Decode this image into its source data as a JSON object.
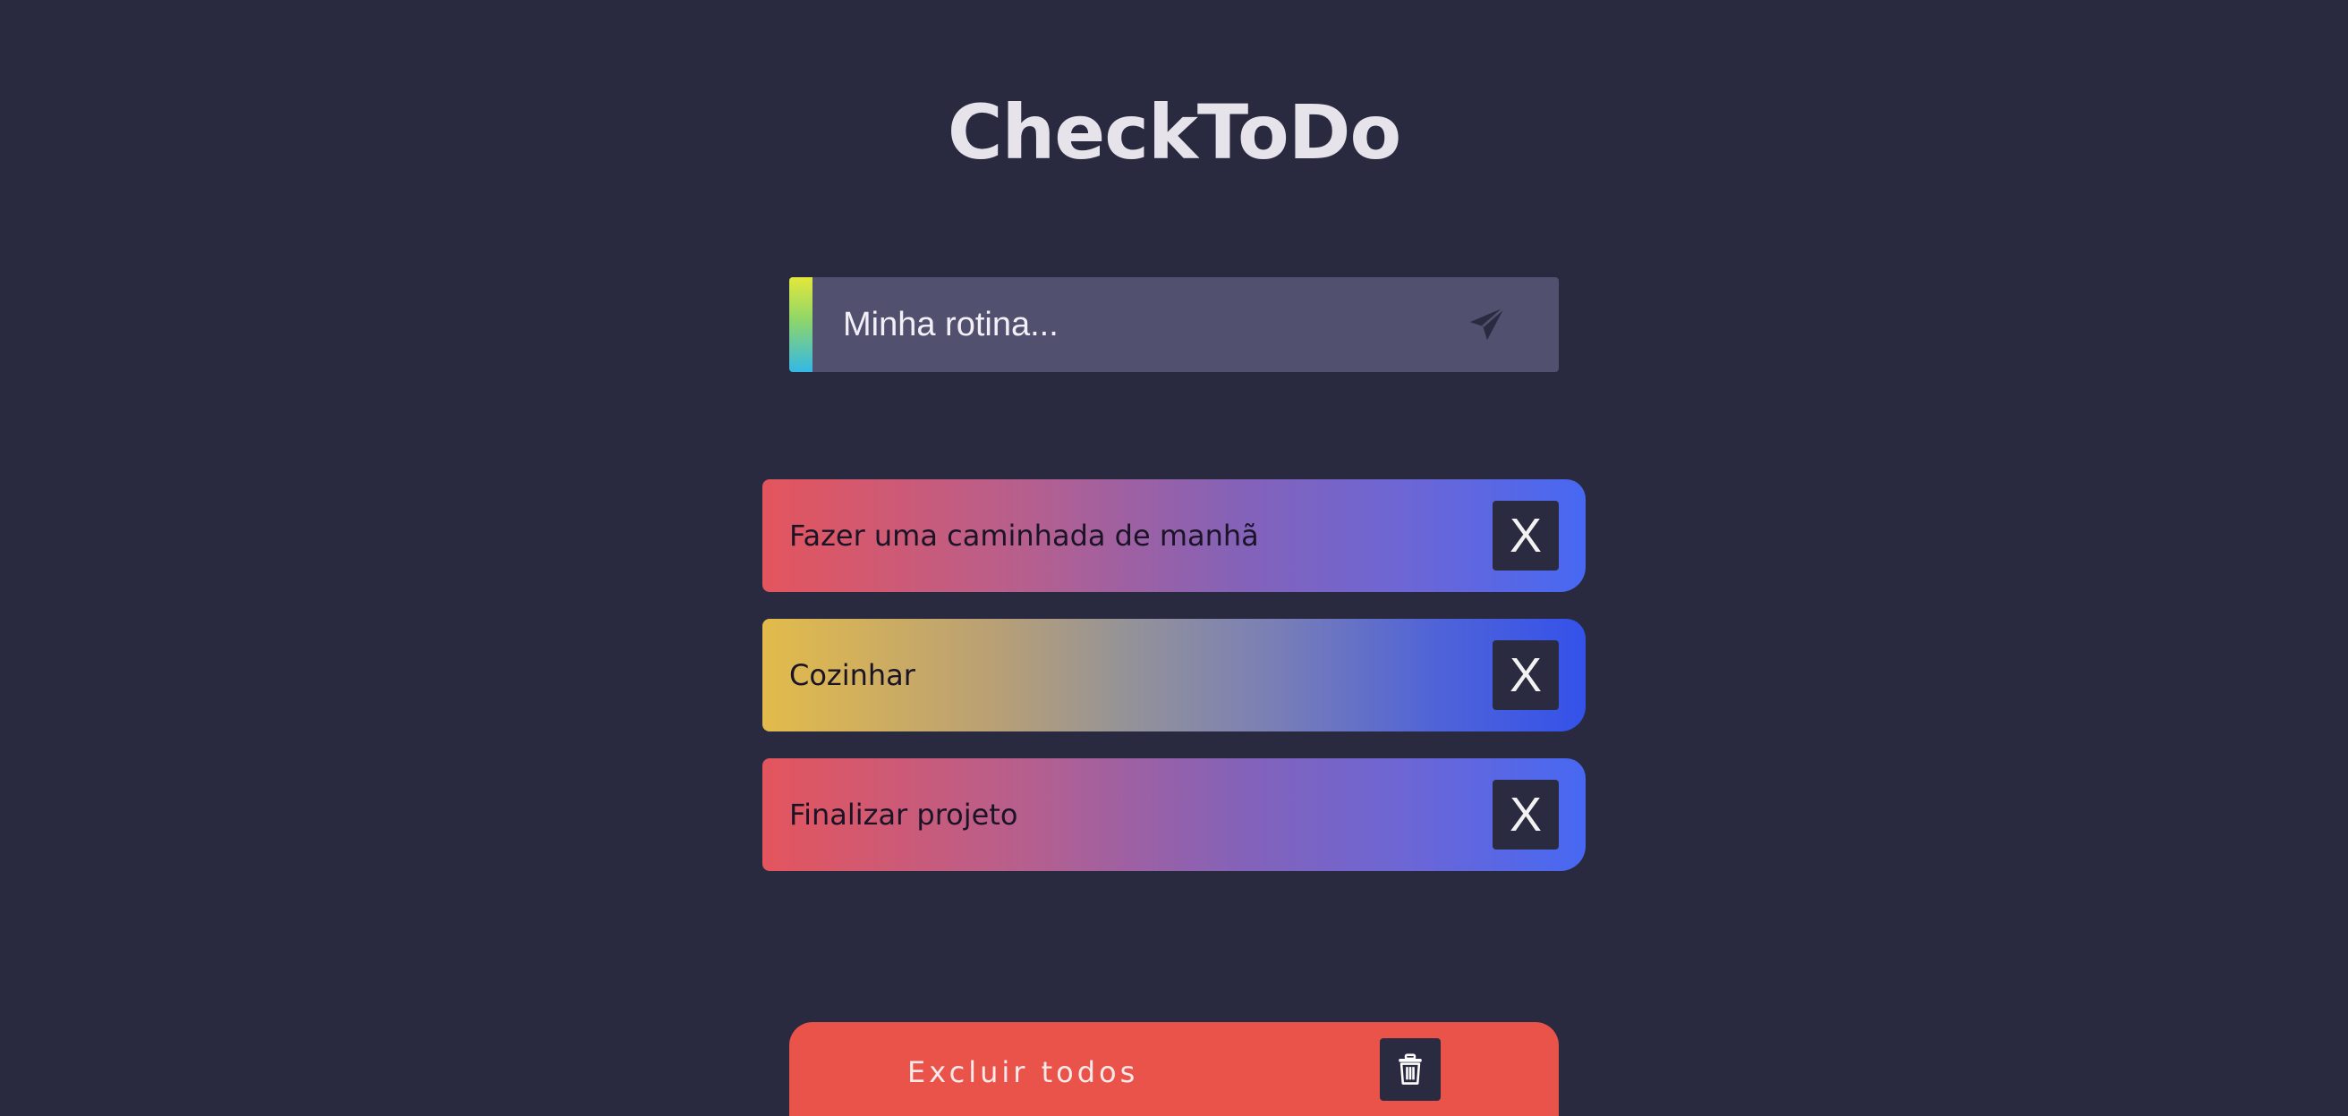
{
  "app": {
    "title": "CheckToDo"
  },
  "input": {
    "placeholder": "Minha rotina...",
    "value": "",
    "send_icon": "paper-plane-icon"
  },
  "todos": [
    {
      "text": "Fazer uma caminhada de manhã",
      "delete_label": "X"
    },
    {
      "text": "Cozinhar",
      "delete_label": "X"
    },
    {
      "text": "Finalizar projeto",
      "delete_label": "X"
    }
  ],
  "clear_all": {
    "label": "Excluir todos",
    "icon": "trash-icon"
  },
  "colors": {
    "background": "#292940",
    "input_bg": "#52506f",
    "clear_all_bg": "#ea5349",
    "button_dark": "#2a2a40"
  }
}
